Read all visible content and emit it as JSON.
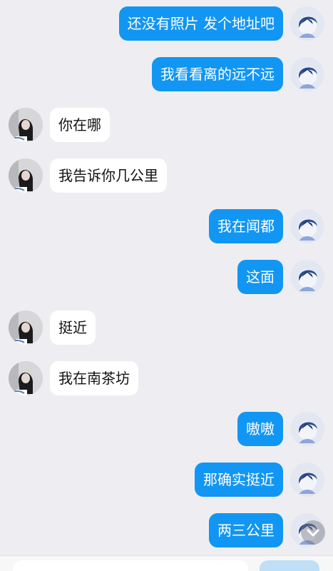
{
  "colors": {
    "background": "#EEEEF2",
    "my_bubble": "#1296F3",
    "my_text": "#FFFFFF",
    "their_bubble": "#FFFFFF",
    "their_text": "#111111",
    "send_button_disabled": "#BFDFF7"
  },
  "messages": [
    {
      "sender": "me",
      "text": "还没有照片 发个地址吧"
    },
    {
      "sender": "me",
      "text": "我看看离的远不远"
    },
    {
      "sender": "other",
      "text": "你在哪"
    },
    {
      "sender": "other",
      "text": "我告诉你几公里"
    },
    {
      "sender": "me",
      "text": "我在闻都"
    },
    {
      "sender": "me",
      "text": "这面"
    },
    {
      "sender": "other",
      "text": "挺近"
    },
    {
      "sender": "other",
      "text": "我在南茶坊"
    },
    {
      "sender": "me",
      "text": "嗷嗷"
    },
    {
      "sender": "me",
      "text": "那确实挺近"
    },
    {
      "sender": "me",
      "text": "两三公里"
    }
  ],
  "icons": {
    "scroll_down": "chevron-down-icon"
  }
}
